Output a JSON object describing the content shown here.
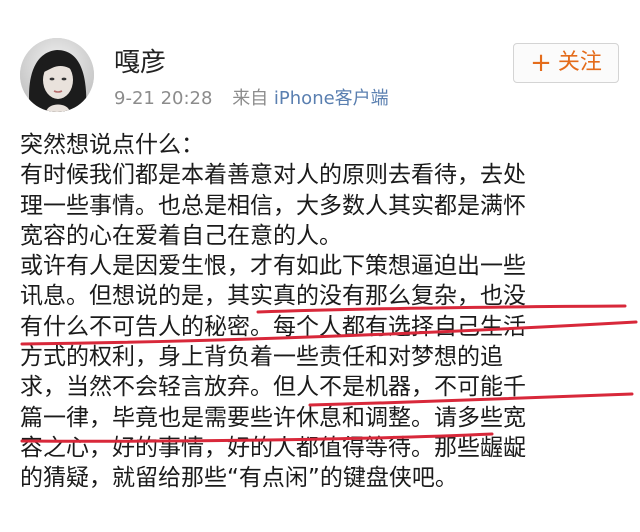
{
  "post": {
    "author": {
      "name": "嘎彦",
      "avatar_icon": "avatar-photo"
    },
    "meta": {
      "time": "9-21 20:28",
      "source_prefix": "来自",
      "source_app": "iPhone客户端"
    },
    "follow_button": {
      "icon": "plus-icon",
      "plus_glyph": "+",
      "label": "关注",
      "color": "#e46c1b"
    },
    "body_lines": [
      "突然想说点什么：",
      "有时候我们都是本着善意对人的原则去看待，去处",
      "理一些事情。也总是相信，大多数人其实都是满怀",
      "宽容的心在爱着自己在意的人。",
      "或许有人是因爱生恨，才有如此下策想逼迫出一些",
      "讯息。但想说的是，其实真的没有那么复杂，也没",
      "有什么不可告人的秘密。每个人都有选择自己生活",
      "方式的权利，身上背负着一些责任和对梦想的追",
      "求，当然不会轻言放弃。但人不是机器，不可能千",
      "篇一律，毕竟也是需要些许休息和调整。请多些宽",
      "容之心，好的事情，好的人都值得等待。那些龌龊",
      "的猜疑，就留给那些“有点闲”的键盘侠吧。"
    ],
    "annotation_color": "#d8283a"
  }
}
